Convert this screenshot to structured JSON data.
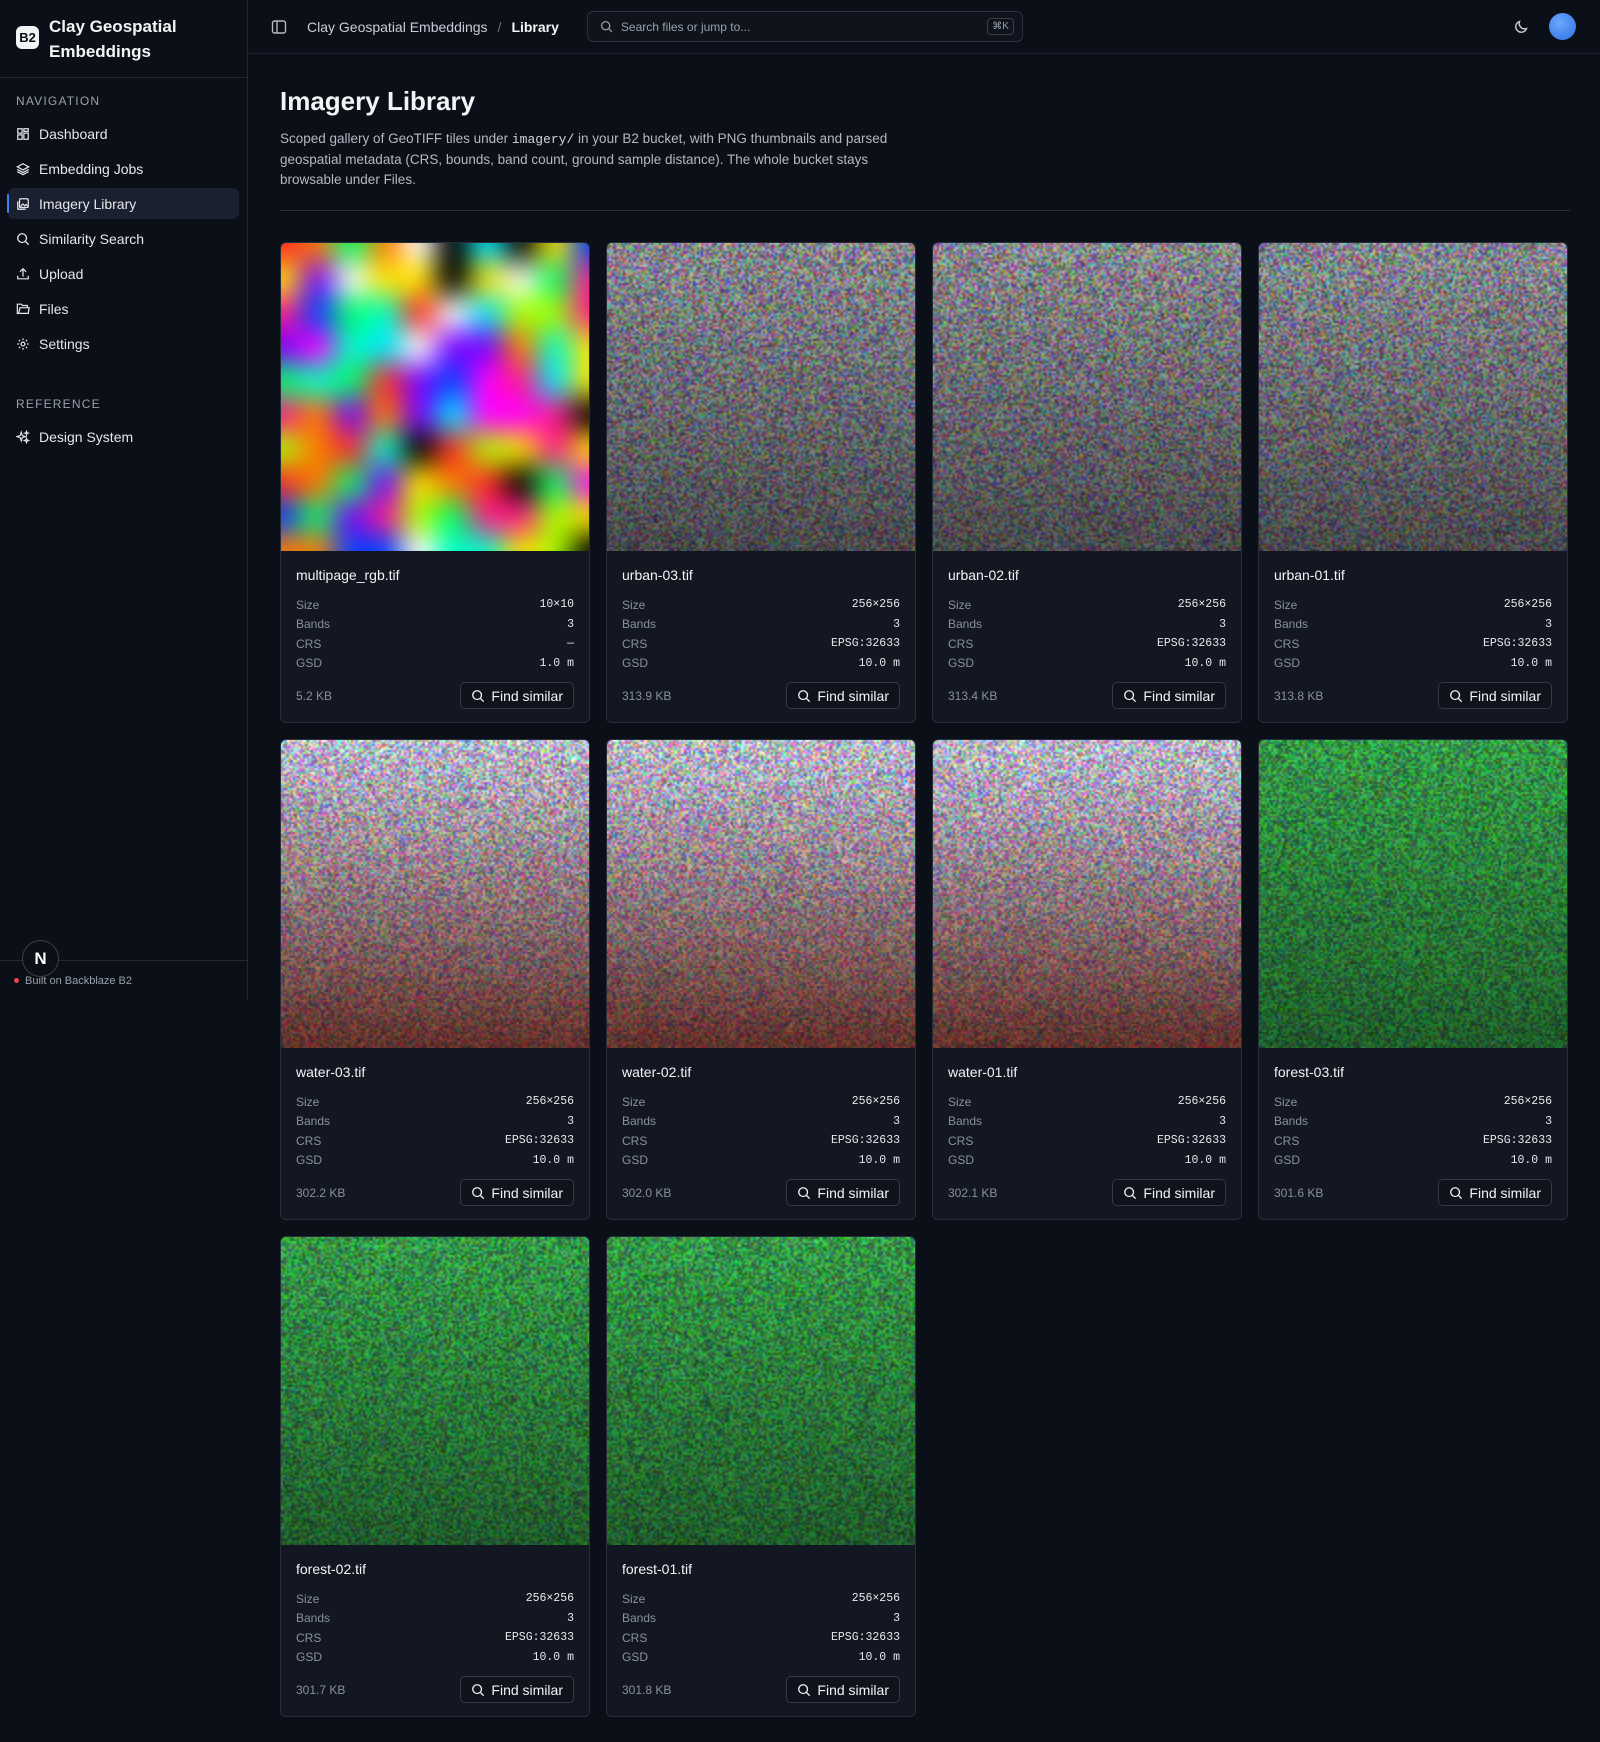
{
  "brand": {
    "badge": "B2",
    "name": "Clay Geospatial Embeddings"
  },
  "sidebar": {
    "sections": [
      {
        "heading": "Navigation",
        "items": [
          {
            "label": "Dashboard",
            "icon": "dashboard-icon",
            "active": false
          },
          {
            "label": "Embedding Jobs",
            "icon": "layers-icon",
            "active": false
          },
          {
            "label": "Imagery Library",
            "icon": "images-icon",
            "active": true
          },
          {
            "label": "Similarity Search",
            "icon": "search-icon",
            "active": false
          },
          {
            "label": "Upload",
            "icon": "upload-icon",
            "active": false
          },
          {
            "label": "Files",
            "icon": "folder-icon",
            "active": false
          },
          {
            "label": "Settings",
            "icon": "gear-icon",
            "active": false
          }
        ]
      },
      {
        "heading": "Reference",
        "items": [
          {
            "label": "Design System",
            "icon": "sparkles-icon",
            "active": false
          }
        ]
      }
    ],
    "footer": "Built on Backblaze B2",
    "avatar_letter": "N"
  },
  "topbar": {
    "breadcrumb": [
      "Clay Geospatial Embeddings",
      "Library"
    ],
    "search_placeholder": "Search files or jump to...",
    "search_shortcut": "⌘K"
  },
  "page": {
    "title": "Imagery Library",
    "desc_pre": "Scoped gallery of GeoTIFF tiles under ",
    "desc_code": "imagery/",
    "desc_post": " in your B2 bucket, with PNG thumbnails and parsed geospatial metadata (CRS, bounds, band count, ground sample distance). The whole bucket stays browsable under Files."
  },
  "card_labels": {
    "size": "Size",
    "bands": "Bands",
    "crs": "CRS",
    "gsd": "GSD",
    "action": "Find similar"
  },
  "cards": [
    {
      "name": "multipage_rgb.tif",
      "size": "10×10",
      "bands": "3",
      "crs": "—",
      "gsd": "1.0 m",
      "file_size": "5.2 KB",
      "pattern": "mosaic"
    },
    {
      "name": "urban-03.tif",
      "size": "256×256",
      "bands": "3",
      "crs": "EPSG:32633",
      "gsd": "10.0 m",
      "file_size": "313.9 KB",
      "pattern": "urban"
    },
    {
      "name": "urban-02.tif",
      "size": "256×256",
      "bands": "3",
      "crs": "EPSG:32633",
      "gsd": "10.0 m",
      "file_size": "313.4 KB",
      "pattern": "urban"
    },
    {
      "name": "urban-01.tif",
      "size": "256×256",
      "bands": "3",
      "crs": "EPSG:32633",
      "gsd": "10.0 m",
      "file_size": "313.8 KB",
      "pattern": "urban"
    },
    {
      "name": "water-03.tif",
      "size": "256×256",
      "bands": "3",
      "crs": "EPSG:32633",
      "gsd": "10.0 m",
      "file_size": "302.2 KB",
      "pattern": "water"
    },
    {
      "name": "water-02.tif",
      "size": "256×256",
      "bands": "3",
      "crs": "EPSG:32633",
      "gsd": "10.0 m",
      "file_size": "302.0 KB",
      "pattern": "water"
    },
    {
      "name": "water-01.tif",
      "size": "256×256",
      "bands": "3",
      "crs": "EPSG:32633",
      "gsd": "10.0 m",
      "file_size": "302.1 KB",
      "pattern": "water"
    },
    {
      "name": "forest-03.tif",
      "size": "256×256",
      "bands": "3",
      "crs": "EPSG:32633",
      "gsd": "10.0 m",
      "file_size": "301.6 KB",
      "pattern": "forest"
    },
    {
      "name": "forest-02.tif",
      "size": "256×256",
      "bands": "3",
      "crs": "EPSG:32633",
      "gsd": "10.0 m",
      "file_size": "301.7 KB",
      "pattern": "forest"
    },
    {
      "name": "forest-01.tif",
      "size": "256×256",
      "bands": "3",
      "crs": "EPSG:32633",
      "gsd": "10.0 m",
      "file_size": "301.8 KB",
      "pattern": "forest"
    }
  ]
}
